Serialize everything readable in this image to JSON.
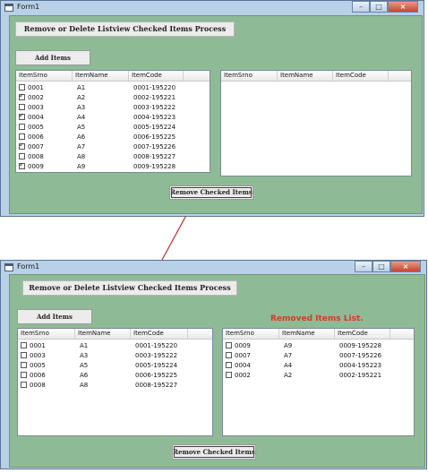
{
  "window_title": "Form1",
  "caption_buttons": {
    "minimize": "–",
    "maximize": "□",
    "close": "×"
  },
  "title_label": "Remove or Delete Listview Checked Items Process",
  "add_button": "Add Items",
  "remove_button": "Remove Checked Items",
  "removed_label": "Removed Items List.",
  "columns": [
    "ItemSrno",
    "ItemName",
    "ItemCode"
  ],
  "before": {
    "left_rows": [
      {
        "srno": "0001",
        "name": "A1",
        "code": "0001-195220",
        "checked": false
      },
      {
        "srno": "0002",
        "name": "A2",
        "code": "0002-195221",
        "checked": true
      },
      {
        "srno": "0003",
        "name": "A3",
        "code": "0003-195222",
        "checked": false
      },
      {
        "srno": "0004",
        "name": "A4",
        "code": "0004-195223",
        "checked": true
      },
      {
        "srno": "0005",
        "name": "A5",
        "code": "0005-195224",
        "checked": false
      },
      {
        "srno": "0006",
        "name": "A6",
        "code": "0006-195225",
        "checked": false
      },
      {
        "srno": "0007",
        "name": "A7",
        "code": "0007-195226",
        "checked": true
      },
      {
        "srno": "0008",
        "name": "A8",
        "code": "0008-195227",
        "checked": false
      },
      {
        "srno": "0009",
        "name": "A9",
        "code": "0009-195228",
        "checked": true
      }
    ],
    "right_rows": []
  },
  "after": {
    "left_rows": [
      {
        "srno": "0001",
        "name": "A1",
        "code": "0001-195220",
        "checked": false
      },
      {
        "srno": "0003",
        "name": "A3",
        "code": "0003-195222",
        "checked": false
      },
      {
        "srno": "0005",
        "name": "A5",
        "code": "0005-195224",
        "checked": false
      },
      {
        "srno": "0006",
        "name": "A6",
        "code": "0006-195225",
        "checked": false
      },
      {
        "srno": "0008",
        "name": "A8",
        "code": "0008-195227",
        "checked": false
      }
    ],
    "right_rows": [
      {
        "srno": "0009",
        "name": "A9",
        "code": "0009-195228",
        "checked": false
      },
      {
        "srno": "0007",
        "name": "A7",
        "code": "0007-195226",
        "checked": false
      },
      {
        "srno": "0004",
        "name": "A4",
        "code": "0004-195223",
        "checked": false
      },
      {
        "srno": "0002",
        "name": "A2",
        "code": "0002-195221",
        "checked": false
      }
    ]
  },
  "colors": {
    "form_bg": "#8fba96",
    "accent_red": "#d63a28",
    "frame": "#b8d0e8"
  },
  "icons": {
    "window": "form-icon",
    "checked": "checkbox-checked-icon",
    "unchecked": "checkbox-unchecked-icon"
  }
}
